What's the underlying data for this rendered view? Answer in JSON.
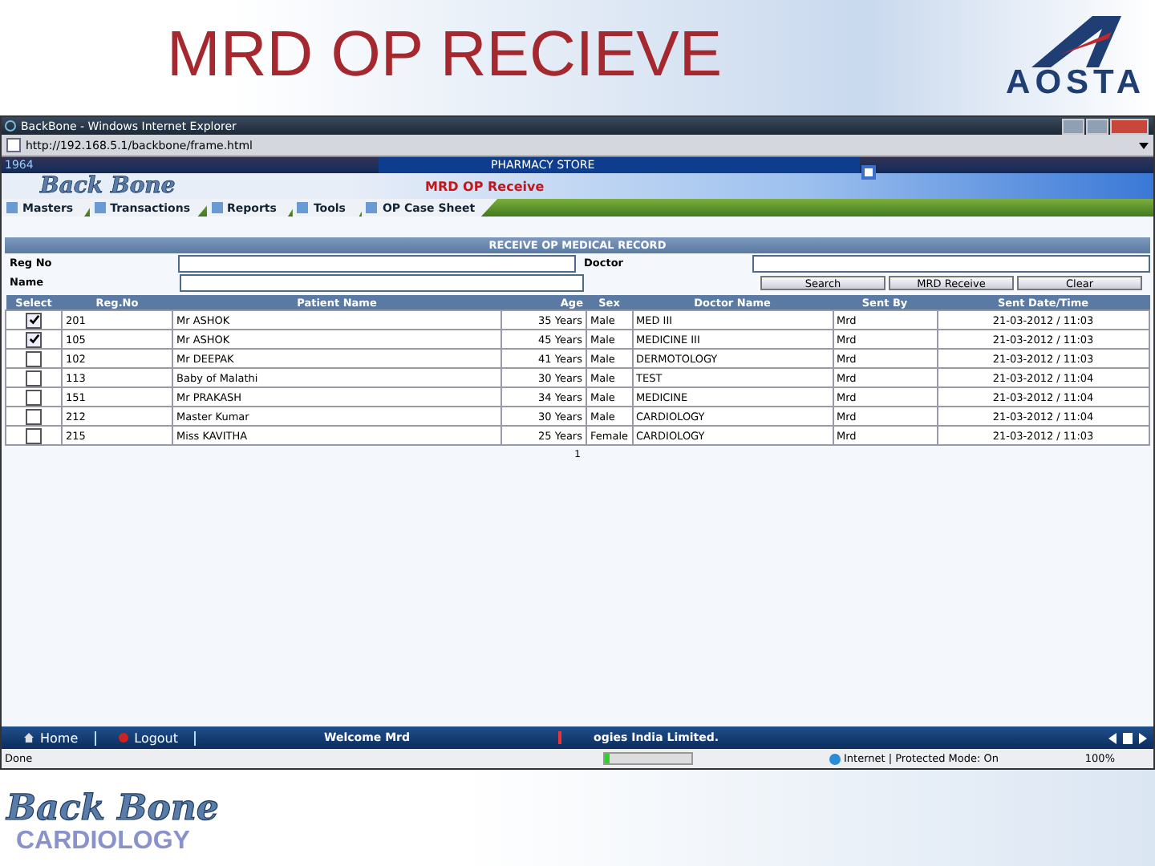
{
  "slide": {
    "title": "MRD OP RECIEVE",
    "logo_text": "AOSTA",
    "footer_logo": "Back Bone",
    "footer_caption": "CARDIOLOGY"
  },
  "browser": {
    "title": "BackBone - Windows Internet Explorer",
    "address": "http://192.168.5.1/backbone/frame.html"
  },
  "app": {
    "corner": "1964",
    "store": "PHARMACY STORE",
    "logo": "Back Bone",
    "page_title": "MRD OP Receive",
    "menu": [
      {
        "label": "Masters"
      },
      {
        "label": "Transactions"
      },
      {
        "label": "Reports"
      },
      {
        "label": "Tools"
      },
      {
        "label": "OP Case Sheet"
      }
    ]
  },
  "form": {
    "title": "RECEIVE OP MEDICAL RECORD",
    "fields": [
      {
        "label": "Reg No"
      },
      {
        "label": "Doctor"
      },
      {
        "label": "Name"
      }
    ],
    "buttons": [
      "Search",
      "MRD Receive",
      "Clear"
    ]
  },
  "table": {
    "select_column": "Select",
    "columns": [
      "Reg.No",
      "Patient Name",
      "Age",
      "Sex",
      "Doctor Name",
      "Sent By",
      "Sent Date/Time"
    ],
    "rows": [
      {
        "checked": true,
        "cells": [
          "201",
          "Mr ASHOK",
          "35 Years",
          "Male",
          "MED III",
          "Mrd",
          "21-03-2012 / 11:03"
        ]
      },
      {
        "checked": true,
        "cells": [
          "105",
          "Mr ASHOK",
          "45 Years",
          "Male",
          "MEDICINE III",
          "Mrd",
          "21-03-2012 / 11:03"
        ]
      },
      {
        "checked": false,
        "cells": [
          "102",
          "Mr DEEPAK",
          "41 Years",
          "Male",
          "DERMOTOLOGY",
          "Mrd",
          "21-03-2012 / 11:03"
        ]
      },
      {
        "checked": false,
        "cells": [
          "113",
          "Baby of Malathi",
          "30 Years",
          "Male",
          "TEST",
          "Mrd",
          "21-03-2012 / 11:04"
        ]
      },
      {
        "checked": false,
        "cells": [
          "151",
          "Mr PRAKASH",
          "34 Years",
          "Male",
          "MEDICINE",
          "Mrd",
          "21-03-2012 / 11:04"
        ]
      },
      {
        "checked": false,
        "cells": [
          "212",
          "Master Kumar",
          "30 Years",
          "Male",
          "CARDIOLOGY",
          "Mrd",
          "21-03-2012 / 11:04"
        ]
      },
      {
        "checked": false,
        "cells": [
          "215",
          "Miss KAVITHA",
          "25 Years",
          "Female",
          "CARDIOLOGY",
          "Mrd",
          "21-03-2012 / 11:03"
        ]
      }
    ],
    "page": "1"
  },
  "footer": {
    "links": [
      "Home",
      "Logout"
    ],
    "welcome": "Welcome Mrd",
    "ticker": "ogies India Limited."
  },
  "status_bar": {
    "text": "Done",
    "progress": {
      "level": 0.06
    },
    "zone": "Internet | Protected Mode: On",
    "zoom": "100%"
  }
}
